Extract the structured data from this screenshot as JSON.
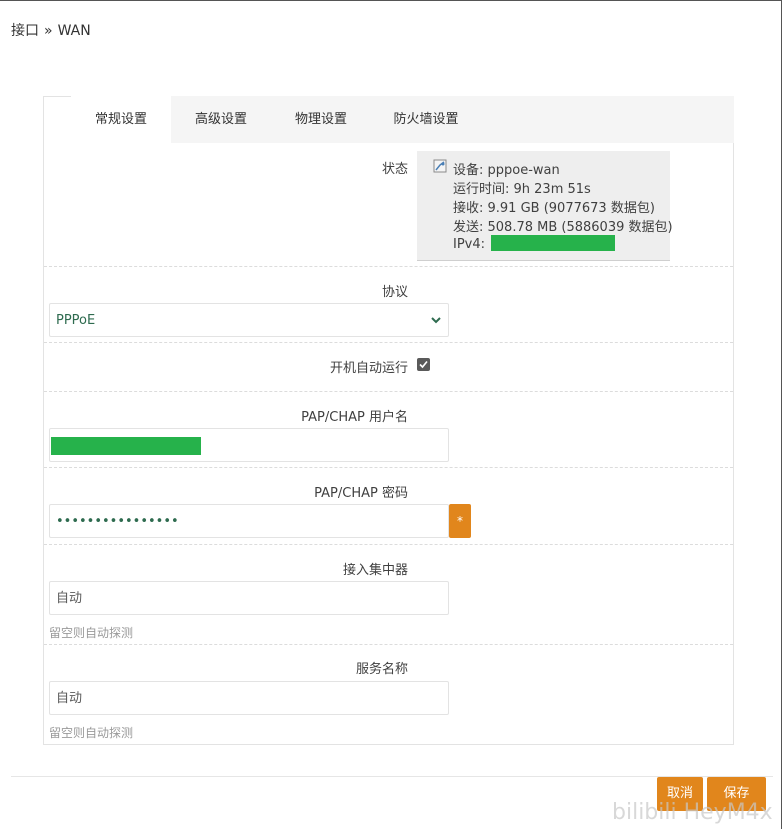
{
  "breadcrumb": {
    "parent": "接口",
    "separator": "»",
    "current": "WAN"
  },
  "tabs": [
    {
      "label": "常规设置",
      "active": true
    },
    {
      "label": "高级设置",
      "active": false
    },
    {
      "label": "物理设置",
      "active": false
    },
    {
      "label": "防火墙设置",
      "active": false
    }
  ],
  "status": {
    "label": "状态",
    "device": "设备: pppoe-wan",
    "uptime": "运行时间: 9h 23m 51s",
    "rx": "接收: 9.91 GB (9077673 数据包)",
    "tx": "发送: 508.78 MB (5886039 数据包)",
    "ipv4_label": "IPv4:"
  },
  "protocol": {
    "label": "协议",
    "value": "PPPoE"
  },
  "autostart": {
    "label": "开机自动运行",
    "checked": true
  },
  "username": {
    "label": "PAP/CHAP 用户名"
  },
  "password": {
    "label": "PAP/CHAP 密码",
    "value": "••••••••••••••••",
    "reveal": "*"
  },
  "concentrator": {
    "label": "接入集中器",
    "placeholder": "自动",
    "hint": "留空则自动探测"
  },
  "service": {
    "label": "服务名称",
    "placeholder": "自动",
    "hint": "留空则自动探测"
  },
  "buttons": {
    "cancel": "取消",
    "save": "保存"
  },
  "watermark": "bilibili HeyM4x",
  "colors": {
    "accent": "#e1861c",
    "redaction": "#26b24b",
    "text_value": "#2e6b4f"
  }
}
